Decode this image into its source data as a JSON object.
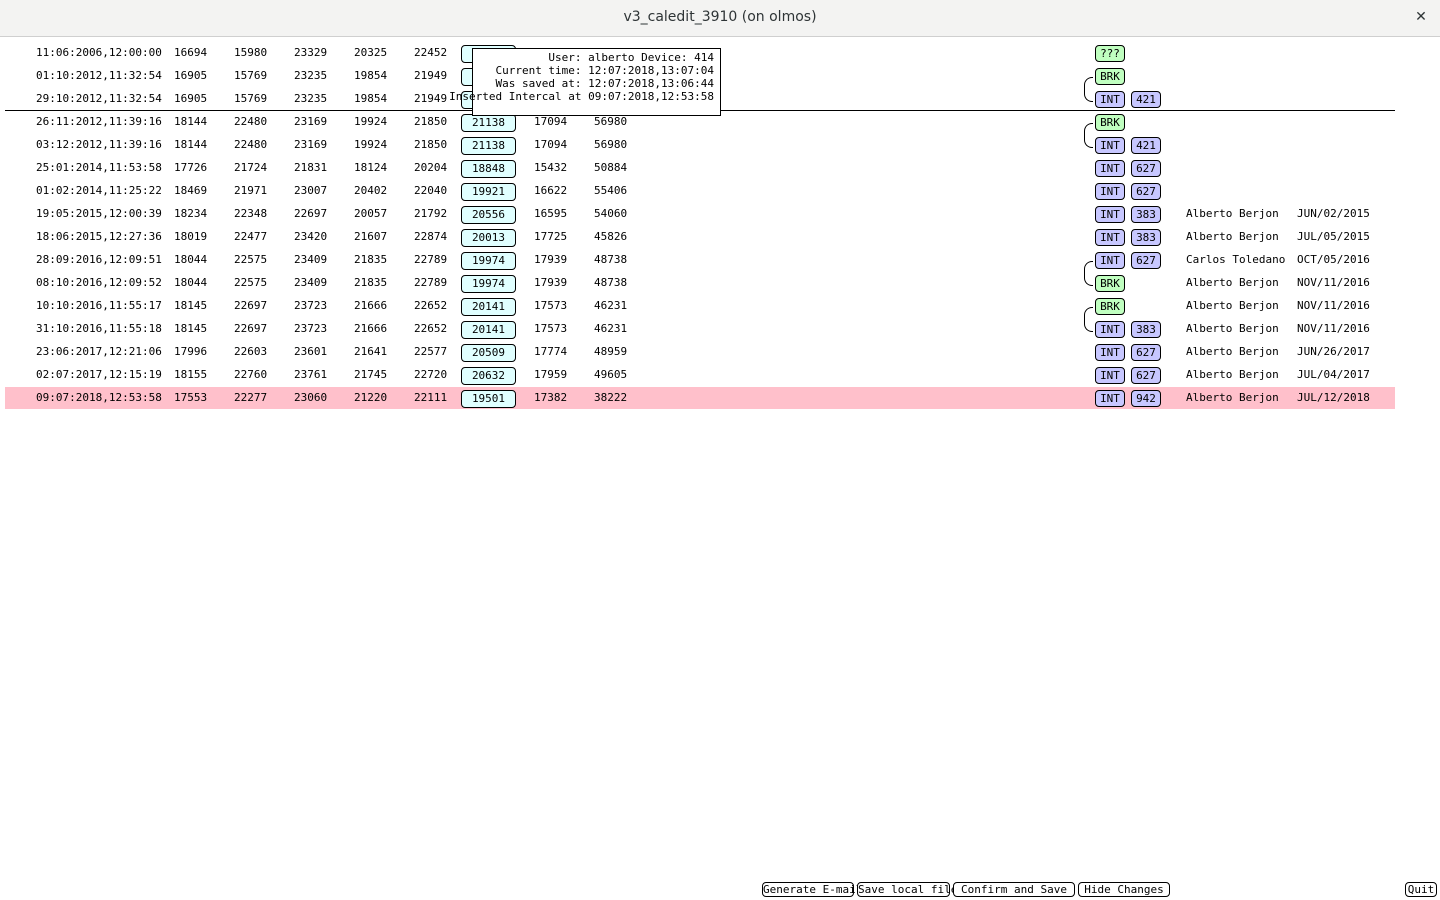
{
  "window": {
    "title": "v3_caledit_3910 (on olmos)",
    "close_glyph": "✕"
  },
  "rows": [
    {
      "date": "11:06:2006,12:00:00",
      "v1": "16694",
      "v2": "15980",
      "v3": "23329",
      "v4": "20325",
      "v5": "22452",
      "edit": "",
      "v6": "",
      "v7": "",
      "type": "???",
      "num": "",
      "user": "",
      "udate": ""
    },
    {
      "date": "01:10:2012,11:32:54",
      "v1": "16905",
      "v2": "15769",
      "v3": "23235",
      "v4": "19854",
      "v5": "21949",
      "edit": "",
      "v6": "",
      "v7": "",
      "type": "BRK",
      "num": "",
      "user": "",
      "udate": ""
    },
    {
      "date": "29:10:2012,11:32:54",
      "v1": "16905",
      "v2": "15769",
      "v3": "23235",
      "v4": "19854",
      "v5": "21949",
      "edit": "",
      "v6": "",
      "v7": "",
      "type": "INT",
      "num": "421",
      "user": "",
      "udate": ""
    },
    {
      "date": "26:11:2012,11:39:16",
      "v1": "18144",
      "v2": "22480",
      "v3": "23169",
      "v4": "19924",
      "v5": "21850",
      "edit": "21138",
      "v6": "17094",
      "v7": "56980",
      "type": "BRK",
      "num": "",
      "user": "",
      "udate": ""
    },
    {
      "date": "03:12:2012,11:39:16",
      "v1": "18144",
      "v2": "22480",
      "v3": "23169",
      "v4": "19924",
      "v5": "21850",
      "edit": "21138",
      "v6": "17094",
      "v7": "56980",
      "type": "INT",
      "num": "421",
      "user": "",
      "udate": ""
    },
    {
      "date": "25:01:2014,11:53:58",
      "v1": "17726",
      "v2": "21724",
      "v3": "21831",
      "v4": "18124",
      "v5": "20204",
      "edit": "18848",
      "v6": "15432",
      "v7": "50884",
      "type": "INT",
      "num": "627",
      "user": "",
      "udate": ""
    },
    {
      "date": "01:02:2014,11:25:22",
      "v1": "18469",
      "v2": "21971",
      "v3": "23007",
      "v4": "20402",
      "v5": "22040",
      "edit": "19921",
      "v6": "16622",
      "v7": "55406",
      "type": "INT",
      "num": "627",
      "user": "",
      "udate": ""
    },
    {
      "date": "19:05:2015,12:00:39",
      "v1": "18234",
      "v2": "22348",
      "v3": "22697",
      "v4": "20057",
      "v5": "21792",
      "edit": "20556",
      "v6": "16595",
      "v7": "54060",
      "type": "INT",
      "num": "383",
      "user": "Alberto Berjon",
      "udate": "JUN/02/2015"
    },
    {
      "date": "18:06:2015,12:27:36",
      "v1": "18019",
      "v2": "22477",
      "v3": "23420",
      "v4": "21607",
      "v5": "22874",
      "edit": "20013",
      "v6": "17725",
      "v7": "45826",
      "type": "INT",
      "num": "383",
      "user": "Alberto Berjon",
      "udate": "JUL/05/2015"
    },
    {
      "date": "28:09:2016,12:09:51",
      "v1": "18044",
      "v2": "22575",
      "v3": "23409",
      "v4": "21835",
      "v5": "22789",
      "edit": "19974",
      "v6": "17939",
      "v7": "48738",
      "type": "INT",
      "num": "627",
      "user": "Carlos Toledano",
      "udate": "OCT/05/2016"
    },
    {
      "date": "08:10:2016,12:09:52",
      "v1": "18044",
      "v2": "22575",
      "v3": "23409",
      "v4": "21835",
      "v5": "22789",
      "edit": "19974",
      "v6": "17939",
      "v7": "48738",
      "type": "BRK",
      "num": "",
      "user": "Alberto Berjon",
      "udate": "NOV/11/2016"
    },
    {
      "date": "10:10:2016,11:55:17",
      "v1": "18145",
      "v2": "22697",
      "v3": "23723",
      "v4": "21666",
      "v5": "22652",
      "edit": "20141",
      "v6": "17573",
      "v7": "46231",
      "type": "BRK",
      "num": "",
      "user": "Alberto Berjon",
      "udate": "NOV/11/2016"
    },
    {
      "date": "31:10:2016,11:55:18",
      "v1": "18145",
      "v2": "22697",
      "v3": "23723",
      "v4": "21666",
      "v5": "22652",
      "edit": "20141",
      "v6": "17573",
      "v7": "46231",
      "type": "INT",
      "num": "383",
      "user": "Alberto Berjon",
      "udate": "NOV/11/2016"
    },
    {
      "date": "23:06:2017,12:21:06",
      "v1": "17996",
      "v2": "22603",
      "v3": "23601",
      "v4": "21641",
      "v5": "22577",
      "edit": "20509",
      "v6": "17774",
      "v7": "48959",
      "type": "INT",
      "num": "627",
      "user": "Alberto Berjon",
      "udate": "JUN/26/2017"
    },
    {
      "date": "02:07:2017,12:15:19",
      "v1": "18155",
      "v2": "22760",
      "v3": "23761",
      "v4": "21745",
      "v5": "22720",
      "edit": "20632",
      "v6": "17959",
      "v7": "49605",
      "type": "INT",
      "num": "627",
      "user": "Alberto Berjon",
      "udate": "JUL/04/2017"
    },
    {
      "date": "09:07:2018,12:53:58",
      "v1": "17553",
      "v2": "22277",
      "v3": "23060",
      "v4": "21220",
      "v5": "22111",
      "edit": "19501",
      "v6": "17382",
      "v7": "38222",
      "type": "INT",
      "num": "942",
      "user": "Alberto Berjon",
      "udate": "JUL/12/2018"
    }
  ],
  "tooltip": {
    "line1": "User: alberto Device: 414",
    "line2": "Current time: 12:07:2018,13:07:04",
    "line3": "Was saved at: 12:07:2018,13:06:44",
    "line4": "Inserted Intercal at 09:07:2018,12:53:58"
  },
  "buttons": {
    "generate_email": "Generate E-mail",
    "save_local": "Save local file",
    "confirm_save": "Confirm and Save",
    "hide_changes": "Hide Changes",
    "quit": "Quit"
  },
  "colors": {
    "current_row": "#ffc0cb",
    "edit_box": "#e0ffff",
    "int_tag": "#c7c7ff",
    "brk_tag": "#c0ffc0"
  }
}
